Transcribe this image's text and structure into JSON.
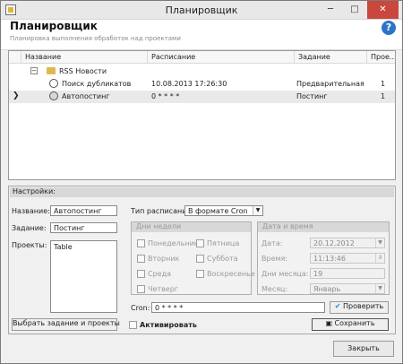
{
  "window": {
    "title": "Планировщик",
    "minimize": "─",
    "maximize": "□",
    "close": "✕"
  },
  "header": {
    "title": "Планировщик",
    "subtitle": "Планировка выполнения обработок над проектами",
    "help_icon": "?"
  },
  "grid": {
    "columns": [
      "Название",
      "Расписание",
      "Задание",
      "Прое..."
    ],
    "rows": [
      {
        "name": "RSS Новости",
        "schedule": "",
        "task": "",
        "project": ""
      },
      {
        "name": "Поиск дубликатов",
        "schedule": "10.08.2013 17:26:30",
        "task": "Предварительная ...",
        "project": "1"
      },
      {
        "name": "Автопостинг",
        "schedule": "0 * * * *",
        "task": "Постинг",
        "project": "1"
      }
    ]
  },
  "settings": {
    "title": "Настройки:",
    "name_label": "Название:",
    "name_value": "Автопостинг",
    "task_label": "Задание:",
    "task_value": "Постинг",
    "projects_label": "Проекты:",
    "projects_value": "Table",
    "schedule_type_label": "Тип расписания:",
    "schedule_type_value": "В формате Cron",
    "weekdays": {
      "title": "Дни недели",
      "days": [
        "Понедельник",
        "Вторник",
        "Среда",
        "Четверг",
        "Пятница",
        "Суббота",
        "Воскресенье"
      ]
    },
    "datetime": {
      "title": "Дата и время",
      "date_label": "Дата:",
      "date_value": "20.12.2012",
      "time_label": "Время:",
      "time_value": "11:13:46",
      "dom_label": "Дни месяца:",
      "dom_value": "19",
      "month_label": "Месяц:",
      "month_value": "Январь"
    },
    "cron_label": "Cron:",
    "cron_value": "0 * * * *",
    "check_button": "Проверить",
    "select_button": "Выбрать задание и проекты",
    "activate_label": "Активировать",
    "save_button": "Сохранить"
  },
  "footer": {
    "close_button": "Закрыть"
  }
}
